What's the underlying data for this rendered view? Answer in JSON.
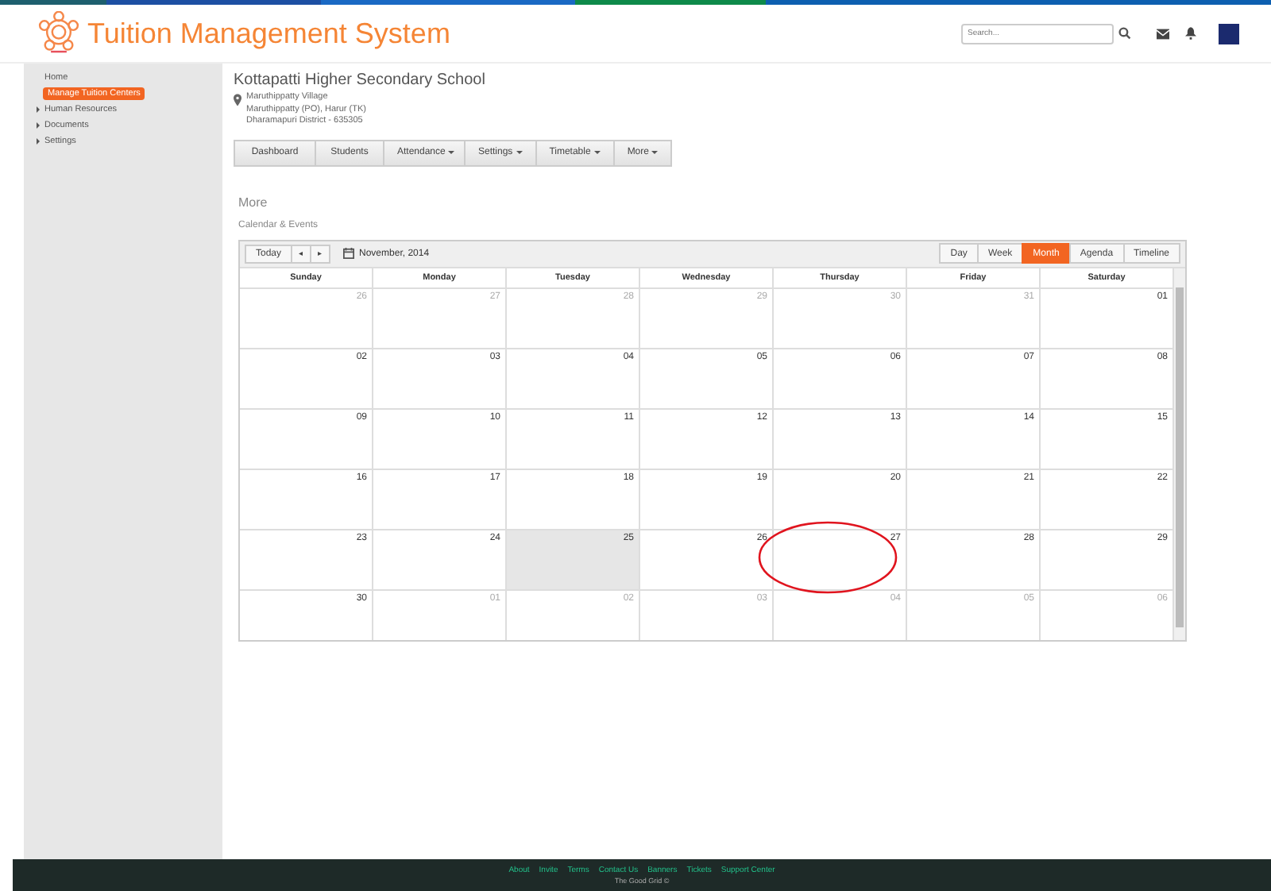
{
  "header": {
    "title": "Tuition Management System",
    "search": {
      "placeholder": "Search..."
    }
  },
  "sidebar": {
    "items": [
      {
        "label": "Home",
        "selected": false,
        "expandable": false
      },
      {
        "label": "Manage Tuition  Centers",
        "selected": true,
        "expandable": false
      },
      {
        "label": "Human Resources",
        "selected": false,
        "expandable": true
      },
      {
        "label": "Documents",
        "selected": false,
        "expandable": true
      },
      {
        "label": "Settings",
        "selected": false,
        "expandable": true
      }
    ]
  },
  "school": {
    "name": "Kottapatti Higher Secondary School",
    "address": [
      "Maruthippatty Village",
      "Maruthippatty (PO), Harur (TK)",
      "Dharamapuri District - 635305"
    ]
  },
  "nav_tabs": [
    {
      "label": "Dashboard",
      "dropdown": false
    },
    {
      "label": "Students",
      "dropdown": false
    },
    {
      "label": "Attendance",
      "dropdown": true
    },
    {
      "label": "Settings",
      "dropdown": true
    },
    {
      "label": "Timetable",
      "dropdown": true
    },
    {
      "label": "More",
      "dropdown": true
    }
  ],
  "section_title": "More",
  "subsection_title": "Calendar & Events",
  "calendar": {
    "today_button": "Today",
    "prev": "◂",
    "next": "▸",
    "month": "November, 2014",
    "views": [
      {
        "label": "Day",
        "selected": false
      },
      {
        "label": "Week",
        "selected": false
      },
      {
        "label": "Month",
        "selected": true
      },
      {
        "label": "Agenda",
        "selected": false
      },
      {
        "label": "Timeline",
        "selected": false
      }
    ],
    "weekdays": [
      "Sunday",
      "Monday",
      "Tuesday",
      "Wednesday",
      "Thursday",
      "Friday",
      "Saturday"
    ],
    "weeks": [
      [
        {
          "day": "26",
          "muted": true,
          "today": false,
          "circled": false
        },
        {
          "day": "27",
          "muted": true,
          "today": false,
          "circled": false
        },
        {
          "day": "28",
          "muted": true,
          "today": false,
          "circled": false
        },
        {
          "day": "29",
          "muted": true,
          "today": false,
          "circled": false
        },
        {
          "day": "30",
          "muted": true,
          "today": false,
          "circled": false
        },
        {
          "day": "31",
          "muted": true,
          "today": false,
          "circled": false
        },
        {
          "day": "01",
          "muted": false,
          "today": false,
          "circled": false
        }
      ],
      [
        {
          "day": "02",
          "muted": false,
          "today": false,
          "circled": false
        },
        {
          "day": "03",
          "muted": false,
          "today": false,
          "circled": false
        },
        {
          "day": "04",
          "muted": false,
          "today": false,
          "circled": false
        },
        {
          "day": "05",
          "muted": false,
          "today": false,
          "circled": false
        },
        {
          "day": "06",
          "muted": false,
          "today": false,
          "circled": false
        },
        {
          "day": "07",
          "muted": false,
          "today": false,
          "circled": false
        },
        {
          "day": "08",
          "muted": false,
          "today": false,
          "circled": false
        }
      ],
      [
        {
          "day": "09",
          "muted": false,
          "today": false,
          "circled": false
        },
        {
          "day": "10",
          "muted": false,
          "today": false,
          "circled": false
        },
        {
          "day": "11",
          "muted": false,
          "today": false,
          "circled": false
        },
        {
          "day": "12",
          "muted": false,
          "today": false,
          "circled": false
        },
        {
          "day": "13",
          "muted": false,
          "today": false,
          "circled": false
        },
        {
          "day": "14",
          "muted": false,
          "today": false,
          "circled": false
        },
        {
          "day": "15",
          "muted": false,
          "today": false,
          "circled": false
        }
      ],
      [
        {
          "day": "16",
          "muted": false,
          "today": false,
          "circled": false
        },
        {
          "day": "17",
          "muted": false,
          "today": false,
          "circled": false
        },
        {
          "day": "18",
          "muted": false,
          "today": false,
          "circled": false
        },
        {
          "day": "19",
          "muted": false,
          "today": false,
          "circled": false
        },
        {
          "day": "20",
          "muted": false,
          "today": false,
          "circled": false
        },
        {
          "day": "21",
          "muted": false,
          "today": false,
          "circled": false
        },
        {
          "day": "22",
          "muted": false,
          "today": false,
          "circled": false
        }
      ],
      [
        {
          "day": "23",
          "muted": false,
          "today": false,
          "circled": false
        },
        {
          "day": "24",
          "muted": false,
          "today": false,
          "circled": false
        },
        {
          "day": "25",
          "muted": false,
          "today": true,
          "circled": false
        },
        {
          "day": "26",
          "muted": false,
          "today": false,
          "circled": false
        },
        {
          "day": "27",
          "muted": false,
          "today": false,
          "circled": true
        },
        {
          "day": "28",
          "muted": false,
          "today": false,
          "circled": false
        },
        {
          "day": "29",
          "muted": false,
          "today": false,
          "circled": false
        }
      ],
      [
        {
          "day": "30",
          "muted": false,
          "today": false,
          "circled": false
        },
        {
          "day": "01",
          "muted": true,
          "today": false,
          "circled": false
        },
        {
          "day": "02",
          "muted": true,
          "today": false,
          "circled": false
        },
        {
          "day": "03",
          "muted": true,
          "today": false,
          "circled": false
        },
        {
          "day": "04",
          "muted": true,
          "today": false,
          "circled": false
        },
        {
          "day": "05",
          "muted": true,
          "today": false,
          "circled": false
        },
        {
          "day": "06",
          "muted": true,
          "today": false,
          "circled": false
        }
      ]
    ]
  },
  "footer": {
    "links": [
      "About",
      "Invite",
      "Terms",
      "Contact Us",
      "Banners",
      "Tickets",
      "Support Center"
    ],
    "credit": "The Good Grid ©"
  }
}
